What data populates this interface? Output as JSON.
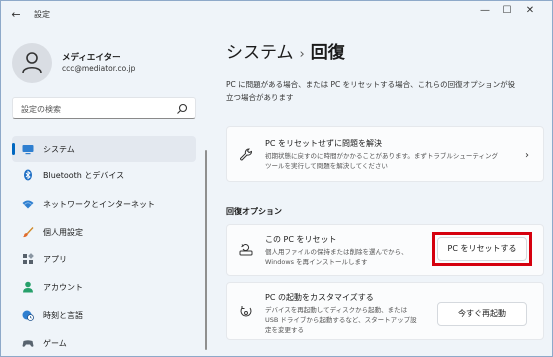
{
  "window": {
    "title": "設定",
    "controls": {
      "minimize": "—",
      "maximize": "☐",
      "close": "✕"
    },
    "back": "←"
  },
  "profile": {
    "name": "メディエイター",
    "email": "ccc@mediator.co.jp"
  },
  "search": {
    "placeholder": "設定の検索"
  },
  "sidebar": {
    "items": [
      {
        "label": "システム",
        "icon": "monitor-icon"
      },
      {
        "label": "Bluetooth とデバイス",
        "icon": "bluetooth-icon"
      },
      {
        "label": "ネットワークとインターネット",
        "icon": "wifi-icon"
      },
      {
        "label": "個人用設定",
        "icon": "brush-icon"
      },
      {
        "label": "アプリ",
        "icon": "apps-icon"
      },
      {
        "label": "アカウント",
        "icon": "account-icon"
      },
      {
        "label": "時刻と言語",
        "icon": "globe-clock-icon"
      },
      {
        "label": "ゲーム",
        "icon": "gamepad-icon"
      }
    ]
  },
  "breadcrumb": {
    "parent": "システム",
    "separator": "›",
    "current": "回復"
  },
  "description": {
    "line1": "PC に問題がある場合、または PC をリセットする場合、これらの回復オプションが役",
    "line2": "立つ場合があります"
  },
  "troubleshoot_card": {
    "title": "PC をリセットせずに問題を解決",
    "desc_line1": "初期状態に戻すのに時間がかかることがあります。まずトラブルシューティング",
    "desc_line2": "ツールを実行して問題を解決してください",
    "chevron": "›"
  },
  "section": {
    "title": "回復オプション"
  },
  "reset_card": {
    "title": "この PC をリセット",
    "desc_line1": "個人用ファイルの保持または削除を選んでから、",
    "desc_line2": "Windows を再インストールします",
    "button": "PC をリセットする"
  },
  "startup_card": {
    "title": "PC の起動をカスタマイズする",
    "desc_line1": "デバイスを再起動してディスクから起動、または",
    "desc_line2": "USB ドライブから起動するなど、スタートアップ設",
    "desc_line3": "定を変更する",
    "button": "今すぐ再起動"
  },
  "colors": {
    "accent": "#0067c0",
    "highlight": "#d5000e",
    "background": "#eff4f9"
  }
}
